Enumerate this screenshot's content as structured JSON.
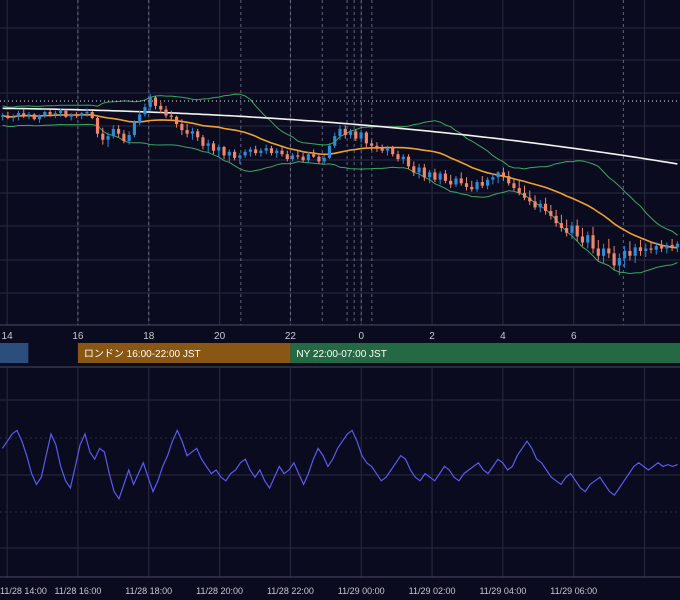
{
  "colors": {
    "background": "#0b0b1f",
    "grid": "#2a2a40",
    "up": "#2e8bd6",
    "down": "#f0876a",
    "bollinger": "#3aa862",
    "ma_mid": "#f0a030",
    "ma_long": "#f2f2f2",
    "oscillator": "#5a5af0",
    "session_tokyo": "#2c4e7c",
    "session_london": "#8a5614",
    "session_ny": "#256844",
    "axis_text": "#c8c8d0"
  },
  "chart_data": [
    {
      "type": "candlestick",
      "name": "price",
      "x_axis": {
        "ticks": [
          "14",
          "16",
          "18",
          "20",
          "22",
          "0",
          "2",
          "4",
          "6"
        ],
        "range_hours": [
          13.8,
          33.0
        ]
      },
      "grid": true,
      "candles": [
        {
          "o": 47,
          "h": 50,
          "l": 44,
          "c": 48
        },
        {
          "o": 48,
          "h": 51,
          "l": 45,
          "c": 46
        },
        {
          "o": 46,
          "h": 49,
          "l": 43,
          "c": 47
        },
        {
          "o": 47,
          "h": 52,
          "l": 44,
          "c": 50
        },
        {
          "o": 50,
          "h": 53,
          "l": 46,
          "c": 48
        },
        {
          "o": 48,
          "h": 51,
          "l": 45,
          "c": 49
        },
        {
          "o": 49,
          "h": 50,
          "l": 44,
          "c": 45
        },
        {
          "o": 45,
          "h": 49,
          "l": 42,
          "c": 48
        },
        {
          "o": 48,
          "h": 52,
          "l": 46,
          "c": 51
        },
        {
          "o": 51,
          "h": 53,
          "l": 47,
          "c": 49
        },
        {
          "o": 49,
          "h": 52,
          "l": 46,
          "c": 50
        },
        {
          "o": 50,
          "h": 54,
          "l": 47,
          "c": 52
        },
        {
          "o": 52,
          "h": 53,
          "l": 46,
          "c": 47
        },
        {
          "o": 47,
          "h": 50,
          "l": 44,
          "c": 49
        },
        {
          "o": 49,
          "h": 51,
          "l": 46,
          "c": 48
        },
        {
          "o": 48,
          "h": 51,
          "l": 45,
          "c": 50
        },
        {
          "o": 50,
          "h": 54,
          "l": 47,
          "c": 51
        },
        {
          "o": 51,
          "h": 52,
          "l": 45,
          "c": 46
        },
        {
          "o": 46,
          "h": 47,
          "l": 30,
          "c": 33
        },
        {
          "o": 33,
          "h": 38,
          "l": 24,
          "c": 28
        },
        {
          "o": 28,
          "h": 34,
          "l": 22,
          "c": 31
        },
        {
          "o": 31,
          "h": 40,
          "l": 29,
          "c": 37
        },
        {
          "o": 37,
          "h": 40,
          "l": 30,
          "c": 33
        },
        {
          "o": 33,
          "h": 36,
          "l": 25,
          "c": 27
        },
        {
          "o": 27,
          "h": 35,
          "l": 24,
          "c": 32
        },
        {
          "o": 32,
          "h": 44,
          "l": 30,
          "c": 42
        },
        {
          "o": 42,
          "h": 52,
          "l": 40,
          "c": 49
        },
        {
          "o": 49,
          "h": 58,
          "l": 47,
          "c": 55
        },
        {
          "o": 55,
          "h": 66,
          "l": 52,
          "c": 63
        },
        {
          "o": 63,
          "h": 64,
          "l": 53,
          "c": 56
        },
        {
          "o": 56,
          "h": 59,
          "l": 50,
          "c": 53
        },
        {
          "o": 53,
          "h": 56,
          "l": 46,
          "c": 48
        },
        {
          "o": 48,
          "h": 52,
          "l": 44,
          "c": 47
        },
        {
          "o": 47,
          "h": 48,
          "l": 38,
          "c": 41
        },
        {
          "o": 41,
          "h": 45,
          "l": 32,
          "c": 36
        },
        {
          "o": 36,
          "h": 41,
          "l": 30,
          "c": 33
        },
        {
          "o": 33,
          "h": 38,
          "l": 28,
          "c": 35
        },
        {
          "o": 35,
          "h": 37,
          "l": 27,
          "c": 30
        },
        {
          "o": 30,
          "h": 32,
          "l": 20,
          "c": 23
        },
        {
          "o": 23,
          "h": 28,
          "l": 18,
          "c": 25
        },
        {
          "o": 25,
          "h": 27,
          "l": 16,
          "c": 19
        },
        {
          "o": 19,
          "h": 24,
          "l": 14,
          "c": 22
        },
        {
          "o": 22,
          "h": 23,
          "l": 12,
          "c": 15
        },
        {
          "o": 15,
          "h": 20,
          "l": 10,
          "c": 18
        },
        {
          "o": 18,
          "h": 20,
          "l": 11,
          "c": 13
        },
        {
          "o": 13,
          "h": 17,
          "l": 8,
          "c": 15
        },
        {
          "o": 15,
          "h": 20,
          "l": 13,
          "c": 18
        },
        {
          "o": 18,
          "h": 22,
          "l": 14,
          "c": 20
        },
        {
          "o": 20,
          "h": 23,
          "l": 15,
          "c": 17
        },
        {
          "o": 17,
          "h": 21,
          "l": 14,
          "c": 19
        },
        {
          "o": 19,
          "h": 24,
          "l": 16,
          "c": 21
        },
        {
          "o": 21,
          "h": 23,
          "l": 15,
          "c": 17
        },
        {
          "o": 17,
          "h": 21,
          "l": 13,
          "c": 19
        },
        {
          "o": 19,
          "h": 22,
          "l": 14,
          "c": 16
        },
        {
          "o": 16,
          "h": 19,
          "l": 10,
          "c": 12
        },
        {
          "o": 12,
          "h": 17,
          "l": 10,
          "c": 15
        },
        {
          "o": 15,
          "h": 19,
          "l": 12,
          "c": 14
        },
        {
          "o": 14,
          "h": 17,
          "l": 9,
          "c": 11
        },
        {
          "o": 11,
          "h": 18,
          "l": 9,
          "c": 16
        },
        {
          "o": 16,
          "h": 20,
          "l": 13,
          "c": 14
        },
        {
          "o": 14,
          "h": 17,
          "l": 8,
          "c": 10
        },
        {
          "o": 10,
          "h": 15,
          "l": 8,
          "c": 13
        },
        {
          "o": 13,
          "h": 25,
          "l": 12,
          "c": 23
        },
        {
          "o": 23,
          "h": 34,
          "l": 21,
          "c": 31
        },
        {
          "o": 31,
          "h": 40,
          "l": 28,
          "c": 37
        },
        {
          "o": 37,
          "h": 40,
          "l": 29,
          "c": 32
        },
        {
          "o": 32,
          "h": 37,
          "l": 29,
          "c": 35
        },
        {
          "o": 35,
          "h": 37,
          "l": 27,
          "c": 29
        },
        {
          "o": 29,
          "h": 36,
          "l": 26,
          "c": 34
        },
        {
          "o": 34,
          "h": 35,
          "l": 22,
          "c": 25
        },
        {
          "o": 25,
          "h": 28,
          "l": 19,
          "c": 23
        },
        {
          "o": 23,
          "h": 26,
          "l": 18,
          "c": 21
        },
        {
          "o": 21,
          "h": 24,
          "l": 17,
          "c": 19
        },
        {
          "o": 19,
          "h": 23,
          "l": 15,
          "c": 21
        },
        {
          "o": 21,
          "h": 23,
          "l": 14,
          "c": 16
        },
        {
          "o": 16,
          "h": 19,
          "l": 10,
          "c": 12
        },
        {
          "o": 12,
          "h": 16,
          "l": 8,
          "c": 14
        },
        {
          "o": 14,
          "h": 16,
          "l": 4,
          "c": 6
        },
        {
          "o": 6,
          "h": 10,
          "l": -2,
          "c": 1
        },
        {
          "o": 1,
          "h": 8,
          "l": -4,
          "c": 5
        },
        {
          "o": 5,
          "h": 8,
          "l": -6,
          "c": -3
        },
        {
          "o": -3,
          "h": 3,
          "l": -8,
          "c": 1
        },
        {
          "o": 1,
          "h": 4,
          "l": -7,
          "c": -5
        },
        {
          "o": -5,
          "h": 2,
          "l": -9,
          "c": 0
        },
        {
          "o": 0,
          "h": 3,
          "l": -8,
          "c": -6
        },
        {
          "o": -6,
          "h": -1,
          "l": -12,
          "c": -9
        },
        {
          "o": -9,
          "h": -2,
          "l": -11,
          "c": -4
        },
        {
          "o": -4,
          "h": 1,
          "l": -10,
          "c": -8
        },
        {
          "o": -8,
          "h": -3,
          "l": -14,
          "c": -11
        },
        {
          "o": -11,
          "h": -6,
          "l": -15,
          "c": -13
        },
        {
          "o": -13,
          "h": -5,
          "l": -15,
          "c": -7
        },
        {
          "o": -7,
          "h": -2,
          "l": -12,
          "c": -10
        },
        {
          "o": -10,
          "h": -3,
          "l": -13,
          "c": -5
        },
        {
          "o": -5,
          "h": 0,
          "l": -9,
          "c": -3
        },
        {
          "o": -3,
          "h": 2,
          "l": -8,
          "c": 1
        },
        {
          "o": 1,
          "h": 5,
          "l": -6,
          "c": -2
        },
        {
          "o": -2,
          "h": 2,
          "l": -10,
          "c": -8
        },
        {
          "o": -8,
          "h": -5,
          "l": -14,
          "c": -12
        },
        {
          "o": -12,
          "h": -6,
          "l": -18,
          "c": -16
        },
        {
          "o": -16,
          "h": -10,
          "l": -22,
          "c": -20
        },
        {
          "o": -20,
          "h": -14,
          "l": -26,
          "c": -23
        },
        {
          "o": -23,
          "h": -18,
          "l": -30,
          "c": -28
        },
        {
          "o": -28,
          "h": -22,
          "l": -32,
          "c": -25
        },
        {
          "o": -25,
          "h": -20,
          "l": -34,
          "c": -31
        },
        {
          "o": -31,
          "h": -26,
          "l": -38,
          "c": -35
        },
        {
          "o": -35,
          "h": -30,
          "l": -44,
          "c": -41
        },
        {
          "o": -41,
          "h": -34,
          "l": -48,
          "c": -45
        },
        {
          "o": -45,
          "h": -38,
          "l": -52,
          "c": -49
        },
        {
          "o": -49,
          "h": -40,
          "l": -54,
          "c": -43
        },
        {
          "o": -43,
          "h": -38,
          "l": -56,
          "c": -52
        },
        {
          "o": -52,
          "h": -45,
          "l": -60,
          "c": -57
        },
        {
          "o": -57,
          "h": -48,
          "l": -62,
          "c": -51
        },
        {
          "o": -51,
          "h": -44,
          "l": -66,
          "c": -62
        },
        {
          "o": -62,
          "h": -55,
          "l": -72,
          "c": -68
        },
        {
          "o": -68,
          "h": -58,
          "l": -75,
          "c": -62
        },
        {
          "o": -62,
          "h": -54,
          "l": -70,
          "c": -66
        },
        {
          "o": -66,
          "h": -60,
          "l": -80,
          "c": -76
        },
        {
          "o": -76,
          "h": -66,
          "l": -84,
          "c": -70
        },
        {
          "o": -70,
          "h": -60,
          "l": -78,
          "c": -64
        },
        {
          "o": -64,
          "h": -56,
          "l": -72,
          "c": -68
        },
        {
          "o": -68,
          "h": -58,
          "l": -74,
          "c": -61
        },
        {
          "o": -61,
          "h": -55,
          "l": -68,
          "c": -64
        },
        {
          "o": -64,
          "h": -58,
          "l": -69,
          "c": -62
        },
        {
          "o": -62,
          "h": -56,
          "l": -66,
          "c": -63
        },
        {
          "o": -63,
          "h": -57,
          "l": -67,
          "c": -60
        },
        {
          "o": -60,
          "h": -55,
          "l": -65,
          "c": -62
        },
        {
          "o": -62,
          "h": -57,
          "l": -66,
          "c": -59
        },
        {
          "o": -59,
          "h": -54,
          "l": -64,
          "c": -61
        },
        {
          "o": -61,
          "h": -56,
          "l": -65,
          "c": -58
        }
      ],
      "overlays": [
        {
          "name": "bollinger-upper",
          "color_key": "bollinger"
        },
        {
          "name": "bollinger-lower",
          "color_key": "bollinger"
        },
        {
          "name": "moving-average-mid",
          "color_key": "ma_mid",
          "period": 21
        },
        {
          "name": "moving-average-long",
          "color_key": "ma_long",
          "period": 200
        }
      ]
    },
    {
      "type": "line",
      "name": "oscillator",
      "grid": true,
      "x_axis": {
        "ticks": [
          "11/28 14:00",
          "11/28 16:00",
          "11/28 18:00",
          "11/28 20:00",
          "11/28 22:00",
          "11/29 00:00",
          "11/29 02:00",
          "11/29 04:00",
          "11/29 06:00"
        ],
        "range_hours": [
          13.8,
          33.0
        ]
      },
      "y_range": [
        0,
        100
      ],
      "values": [
        62,
        66,
        70,
        72,
        66,
        58,
        48,
        42,
        46,
        58,
        70,
        64,
        52,
        44,
        40,
        52,
        64,
        70,
        60,
        56,
        62,
        60,
        48,
        38,
        34,
        42,
        50,
        42,
        48,
        54,
        46,
        38,
        44,
        52,
        58,
        66,
        72,
        66,
        58,
        60,
        62,
        56,
        52,
        48,
        50,
        46,
        44,
        48,
        50,
        54,
        56,
        50,
        46,
        50,
        44,
        40,
        46,
        52,
        48,
        50,
        54,
        48,
        42,
        48,
        56,
        62,
        58,
        52,
        56,
        62,
        66,
        70,
        72,
        66,
        58,
        54,
        52,
        48,
        44,
        46,
        50,
        54,
        58,
        56,
        50,
        46,
        44,
        48,
        46,
        44,
        48,
        52,
        50,
        46,
        44,
        48,
        50,
        52,
        54,
        50,
        48,
        52,
        56,
        54,
        50,
        52,
        58,
        62,
        66,
        62,
        56,
        54,
        50,
        46,
        44,
        42,
        46,
        48,
        44,
        40,
        38,
        42,
        44,
        46,
        42,
        38,
        36,
        40,
        44,
        48,
        52,
        54,
        52,
        50,
        52,
        54,
        52,
        53,
        52,
        53
      ]
    }
  ],
  "sessions": [
    {
      "label": "",
      "start_hour": 13.8,
      "end_hour": 14.6,
      "color_key": "session_tokyo"
    },
    {
      "label": "ロンドン 16:00-22:00 JST",
      "start_hour": 16,
      "end_hour": 22,
      "color_key": "session_london"
    },
    {
      "label": "NY 22:00-07:00 JST",
      "start_hour": 22,
      "end_hour": 33.0,
      "color_key": "session_ny"
    }
  ]
}
